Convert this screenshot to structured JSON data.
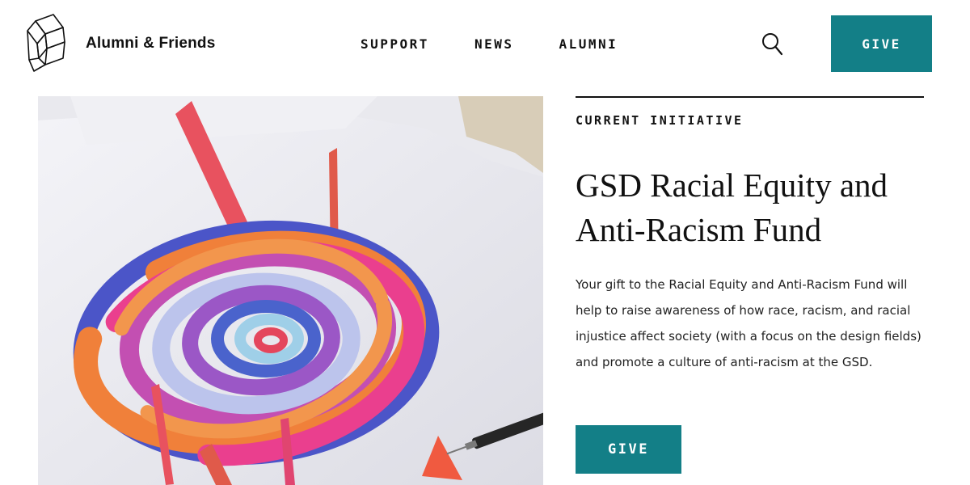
{
  "header": {
    "site_title": "Alumni & Friends",
    "nav": [
      {
        "label": "SUPPORT"
      },
      {
        "label": "NEWS"
      },
      {
        "label": "ALUMNI"
      }
    ],
    "search_icon": "search-icon",
    "give_label": "GIVE"
  },
  "colors": {
    "accent": "#137f87",
    "text": "#111111",
    "background": "#ffffff"
  },
  "main": {
    "eyebrow": "CURRENT INITIATIVE",
    "title": "GSD Racial Equity and Anti-Racism Fund",
    "description": "Your gift to the Racial Equity and Anti-Racism Fund will help to raise awareness of how race, racism, and racial injustice affect society (with a focus on the design fields) and promote a culture of anti-racism at the GSD.",
    "give_label": "GIVE"
  }
}
